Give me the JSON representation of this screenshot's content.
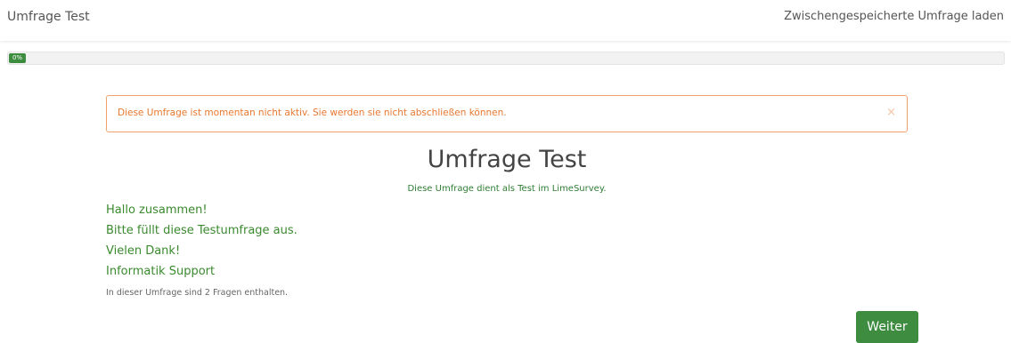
{
  "navbar": {
    "brand": "Umfrage Test",
    "load_saved_link": "Zwischengespeicherte Umfrage laden"
  },
  "progress": {
    "value_percent": 0,
    "label": "0%"
  },
  "alert": {
    "message": "Diese Umfrage ist momentan nicht aktiv. Sie werden sie nicht abschließen können.",
    "close_symbol": "×"
  },
  "survey": {
    "title": "Umfrage Test",
    "description": "Diese Umfrage dient als Test im LimeSurvey.",
    "welcome_lines": [
      "Hallo zusammen!",
      "Bitte füllt diese Testumfrage aus.",
      "Vielen Dank!",
      "Informatik Support"
    ],
    "question_count_text": "In dieser Umfrage sind 2 Fragen enthalten."
  },
  "buttons": {
    "next_label": "Weiter"
  },
  "colors": {
    "accent_green": "#3d8c40",
    "alert_orange": "#e8782f"
  }
}
